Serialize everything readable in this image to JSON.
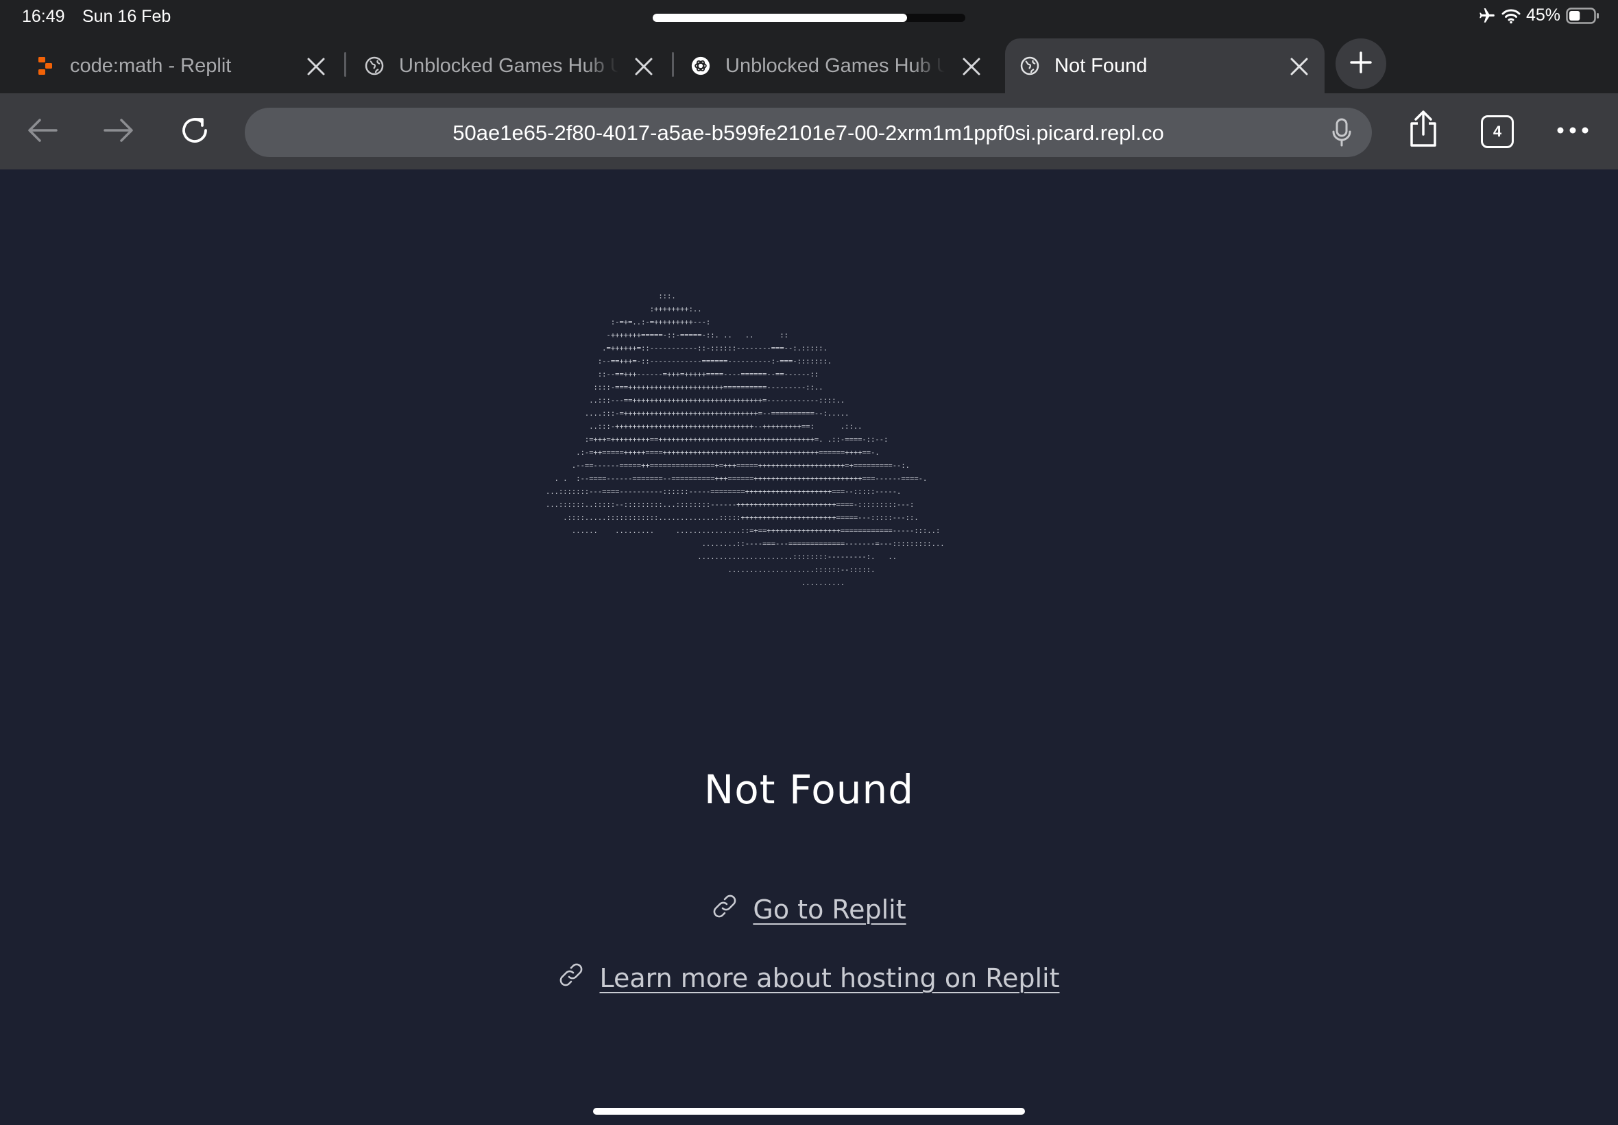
{
  "status_bar": {
    "time": "16:49",
    "date": "Sun 16 Feb",
    "battery_percent": "45%",
    "battery_level": 0.45,
    "icons": [
      "airplane-mode-icon",
      "wifi-icon",
      "battery-icon"
    ]
  },
  "tabs": [
    {
      "title": "code:math - Replit",
      "favicon": "replit-logo-icon",
      "active": false
    },
    {
      "title": "Unblocked Games Hub Unblocked",
      "favicon": "globe-icon",
      "active": false
    },
    {
      "title": "Unblocked Games Hub Unblocked",
      "favicon": "openai-logo-icon",
      "active": false
    },
    {
      "title": "Not Found",
      "favicon": "globe-icon",
      "active": true
    }
  ],
  "toolbar": {
    "url": "50ae1e65-2f80-4017-a5ae-b599fe2101e7-00-2xrm1m1ppf0si.picard.repl.co",
    "tab_count": "4",
    "icons": [
      "back-arrow-icon",
      "forward-arrow-icon",
      "reload-icon",
      "microphone-icon",
      "share-icon",
      "tabs-icon",
      "more-icon"
    ]
  },
  "page": {
    "ascii_art": "                          :::.\n                        :++++++++:..\n               :-=+=..:-=+++++++++---:\n              -+++++++=====-::-=====-::. ..   ..      ::\n             .=++++++=::-----------::-::::::--------===--:.:::::.\n            :--==+++=-::------------======----------:-===-:::::::.\n            ::--==+++------=+++=+++++====----======--==------::\n           ::::-===++++++++++++++++++++++==========---------::..\n          ..:::---==++++++++++++++++++++++++++++++=------------::::..\n         ....:::-=+++++++++++++++++++++++++++++++=--==========--:.....\n          ..:::-++++++++++++++++++++++++++++++++--+++++++++==:      .::..\n         :=+++=+++++++++==++++++++++++++++++++++++++++++++++++=. .::-====-::--:\n       .:-=++=====+++++====++++++++++++++++++++++++++++++++++++======++++==-.\n      .--==------=====++===============+=+++=====++++++++++++++++++++=+=========--:.\n  . .  :--====------=======--==========+++======+++++++++++++++++++++++++===------====-.\n...:::::::---====----------::::::-----========++++++++++++++++++++===--:::::-----.\n...::::::..:::::--:::::::::...::::::::------+++++++++++++++++++++++====-:::::::::---:\n    .::::.....::::::::::::..............:::::++++++++++++++++++++++=====---:::::---::.\n      ......    .........     ...............::=+==+++++++++++++++++============-----:::..:\n                                    ........::----===---=============-------=---:::::::::...\n                                   ......................::::::::---------:.   ..\n                                          ....................::::::--:::::.\n                                                           ..........",
    "title": "Not Found",
    "links": [
      {
        "label": "Go to Replit",
        "icon": "link-icon"
      },
      {
        "label": "Learn more about hosting on Replit",
        "icon": "link-icon"
      }
    ]
  },
  "colors": {
    "page_background": "#1c2030",
    "chrome_background": "#202123",
    "toolbar_background": "#3b3c40",
    "replit_orange": "#f26207"
  }
}
